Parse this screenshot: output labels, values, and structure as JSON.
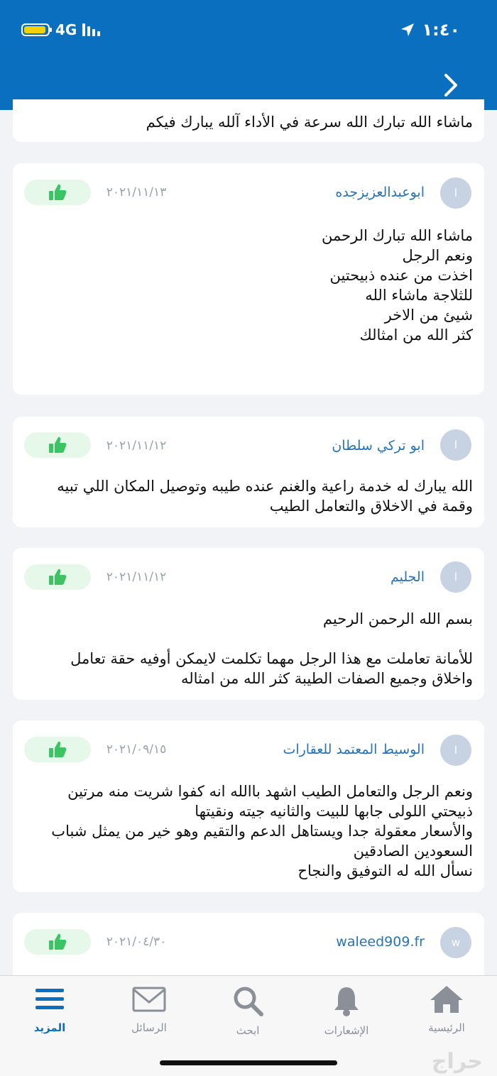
{
  "status": {
    "network": "4G",
    "time": "١:٤٠"
  },
  "colors": {
    "header_blue": "#0b6fbf",
    "like_green": "#3cc463",
    "username_blue": "#2673b9"
  },
  "reviews": {
    "r0": {
      "body": "ماشاء الله تبارك الله سرعة في الأداء آلله يبارك فيكم"
    },
    "r1": {
      "avatar": "ا",
      "user": "ابوعبدالعزيزجده",
      "date": "٢٠٢١/١١/١٣",
      "body": "ماشاء الله تبارك الرحمن\nونعم الرجل\nاخذت من عنده ذبيحتين\nللثلاجة ماشاء الله\nشيئ من الاخر\nكثر الله من امثالك"
    },
    "r2": {
      "avatar": "ا",
      "user": "ابو تركي سلطان",
      "date": "٢٠٢١/١١/١٢",
      "body": "الله يبارك له خدمة راعية والغنم عنده طيبه وتوصيل المكان اللي تبيه\nوقمة في الاخلاق والتعامل الطيب"
    },
    "r3": {
      "avatar": "ا",
      "user": "الجليم",
      "date": "٢٠٢١/١١/١٢",
      "body": "بسم الله الرحمن الرحيم\n\nللأمانة تعاملت مع هذا الرجل مهما تكلمت لايمكن أوفيه حقة تعامل\nواخلاق وجميع الصفات الطيبة كثر الله من امثاله"
    },
    "r4": {
      "avatar": "ا",
      "user": "الوسيط المعتمد للعقارات",
      "date": "٢٠٢١/٠٩/١٥",
      "body": "ونعم الرجل والتعامل الطيب اشهد باالله انه كفوا شريت منه مرتين\nذبيحتي اللولى جابها للبيت والثانيه جيته ونقيتها\nوالأسعار معقولة جدا ويستاهل الدعم والتقيم وهو خير من يمثل شباب\nالسعودين الصادقين\nنسأل الله له التوفيق والنجاح"
    },
    "r5": {
      "avatar": "w",
      "user": "waleed909.fr",
      "date": "٢٠٢١/٠٤/٣٠"
    }
  },
  "tabs": {
    "home": "الرئيسية",
    "notifications": "الإشعارات",
    "search": "ابحث",
    "messages": "الرسائل",
    "more": "المزيد"
  },
  "watermark": "حراج"
}
